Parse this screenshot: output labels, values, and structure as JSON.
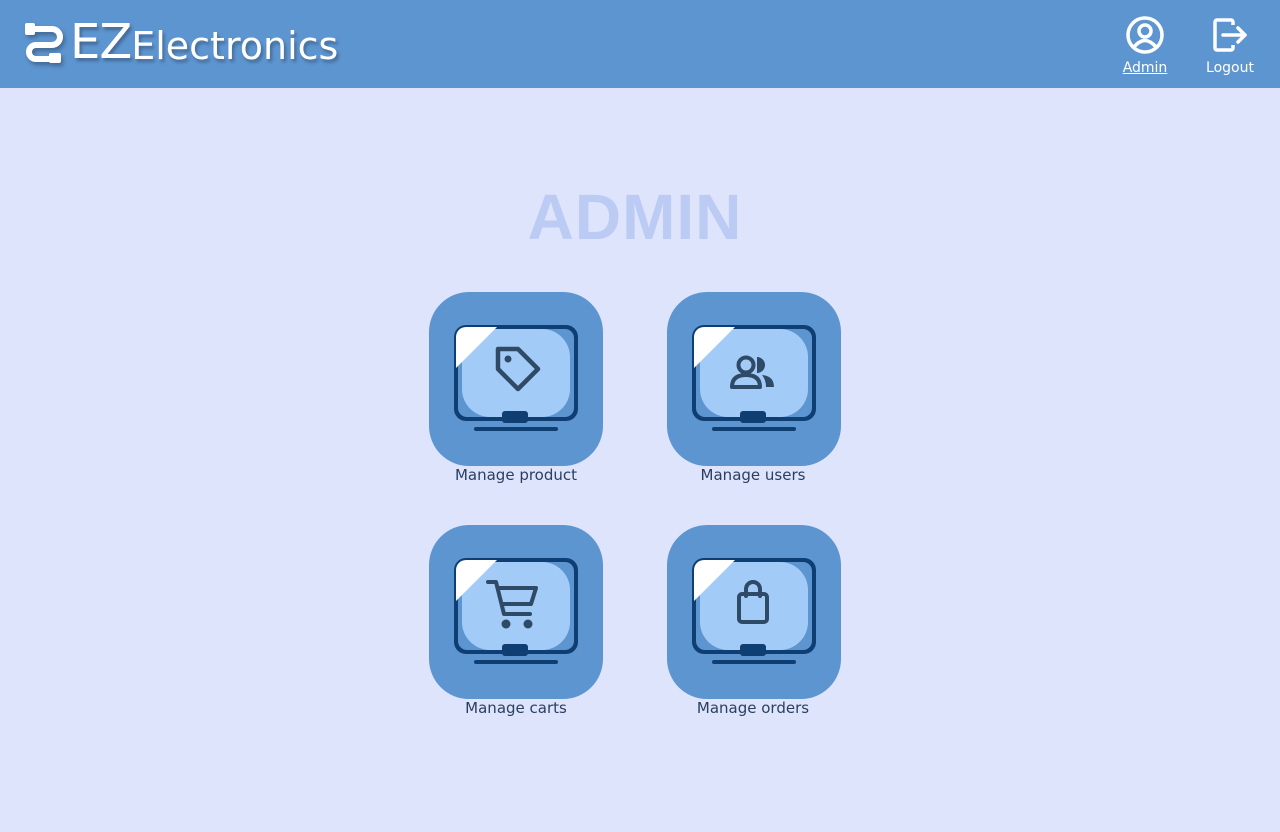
{
  "header": {
    "logo_ez": "EZ",
    "logo_rest": "Electronics",
    "admin_label": "Admin",
    "logout_label": "Logout",
    "logo_icon": "cable-connector-icon",
    "admin_icon": "user-circle-icon",
    "logout_icon": "logout-arrow-icon"
  },
  "main": {
    "title": "ADMIN",
    "tiles": [
      {
        "label": "Manage product",
        "icon": "tag-icon"
      },
      {
        "label": "Manage users",
        "icon": "users-icon"
      },
      {
        "label": "Manage carts",
        "icon": "cart-icon"
      },
      {
        "label": "Manage orders",
        "icon": "bag-icon"
      }
    ]
  },
  "colors": {
    "header_bg": "#5d95d1",
    "page_bg": "#dee4fb",
    "title": "#bccbf4",
    "tile_bg": "#5d95d1",
    "screen": "#a3cbf8",
    "monitor_frame": "#0f3e72",
    "label_text": "#2b3f5e"
  }
}
